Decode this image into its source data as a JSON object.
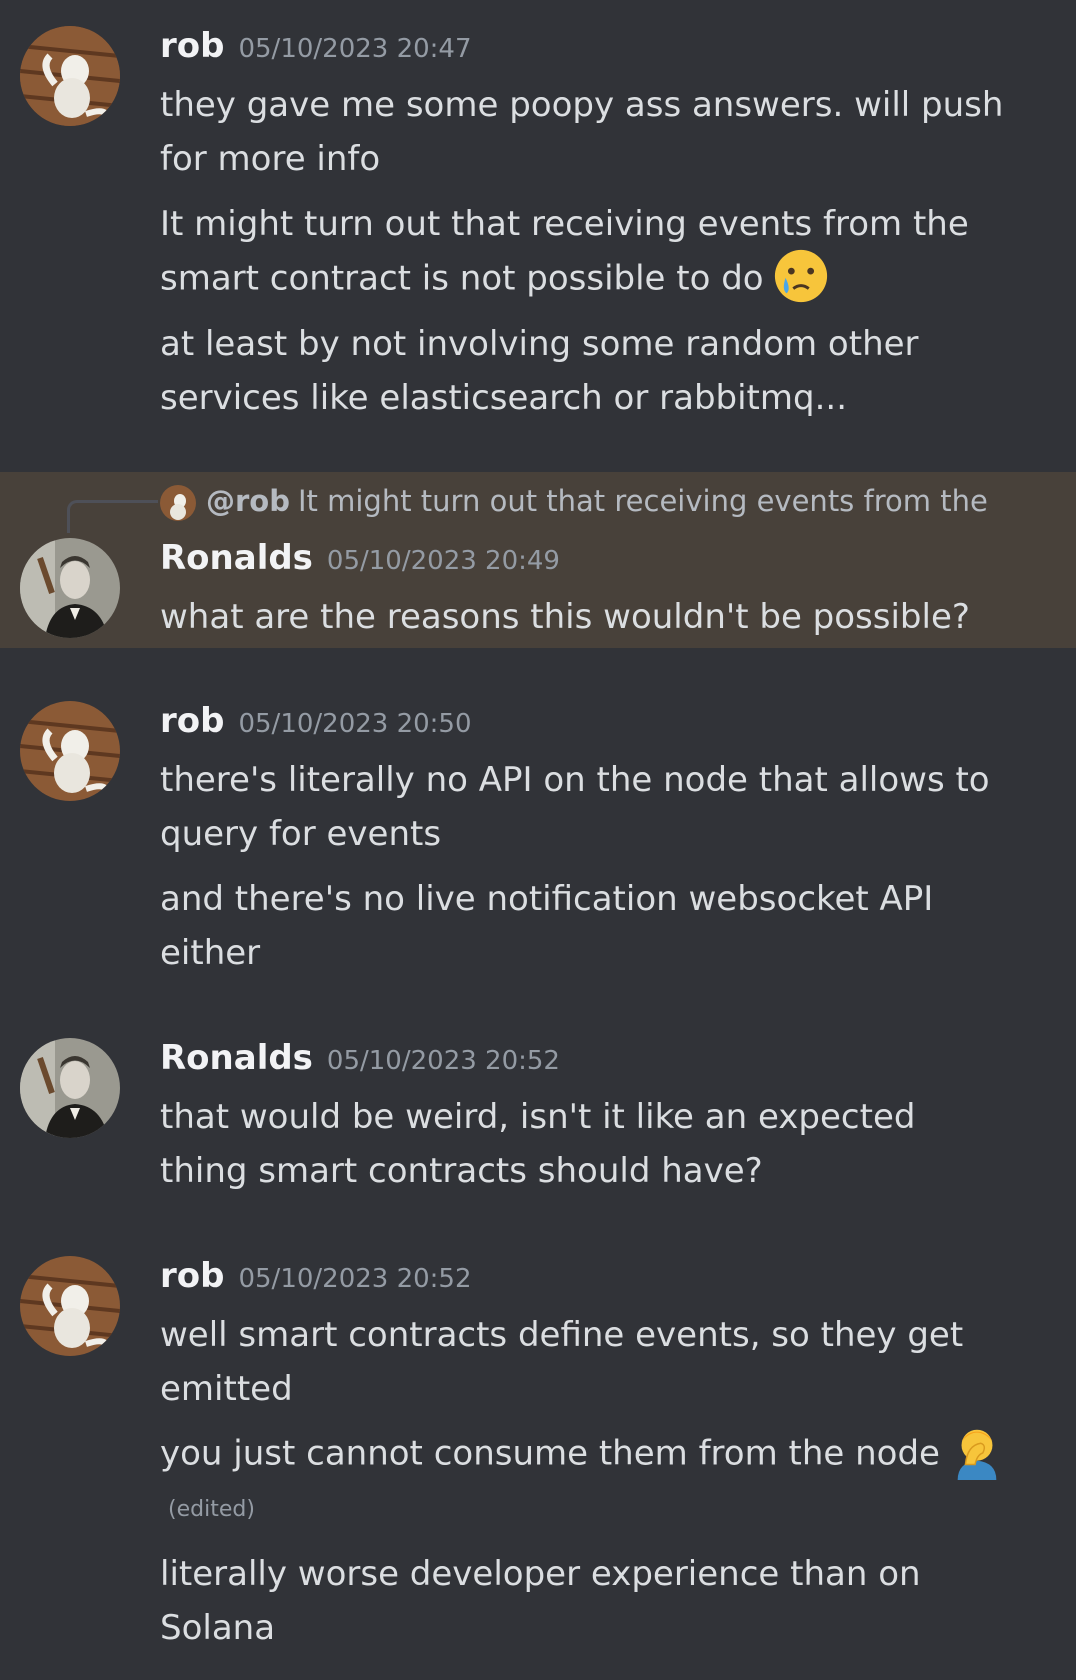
{
  "colors": {
    "background": "#313338",
    "highlight": "#48413a",
    "username": "#f2f3f5",
    "text": "#dbdee1",
    "muted": "#949ba4"
  },
  "messages": [
    {
      "author": "rob",
      "timestamp": "05/10/2023 20:47",
      "lines": [
        "they gave me some poopy ass answers. will push",
        "for more info",
        "It might turn out that receiving events from the",
        "smart contract is not possible to do",
        "at least by not involving some random other",
        "services like elasticsearch or rabbitmq..."
      ],
      "emoji": "crying-face-icon"
    },
    {
      "reply": {
        "mention": "@rob",
        "text": "It might turn out that receiving events from the"
      },
      "author": "Ronalds",
      "timestamp": "05/10/2023 20:49",
      "lines": [
        "what are the reasons this wouldn't be possible?"
      ]
    },
    {
      "author": "rob",
      "timestamp": "05/10/2023 20:50",
      "lines": [
        "there's literally no API on the node that allows to",
        "query for events",
        "and there's no live notification websocket API",
        "either"
      ]
    },
    {
      "author": "Ronalds",
      "timestamp": "05/10/2023 20:52",
      "lines": [
        "that would be weird, isn't it like an expected",
        "thing smart contracts should have?"
      ]
    },
    {
      "author": "rob",
      "timestamp": "05/10/2023 20:52",
      "lines": [
        "well smart contracts define events, so they get",
        "emitted",
        "you just cannot consume them from the node",
        "literally worse developer experience than on",
        "Solana"
      ],
      "edited_label": "(edited)",
      "emoji": "facepalm-icon"
    }
  ]
}
